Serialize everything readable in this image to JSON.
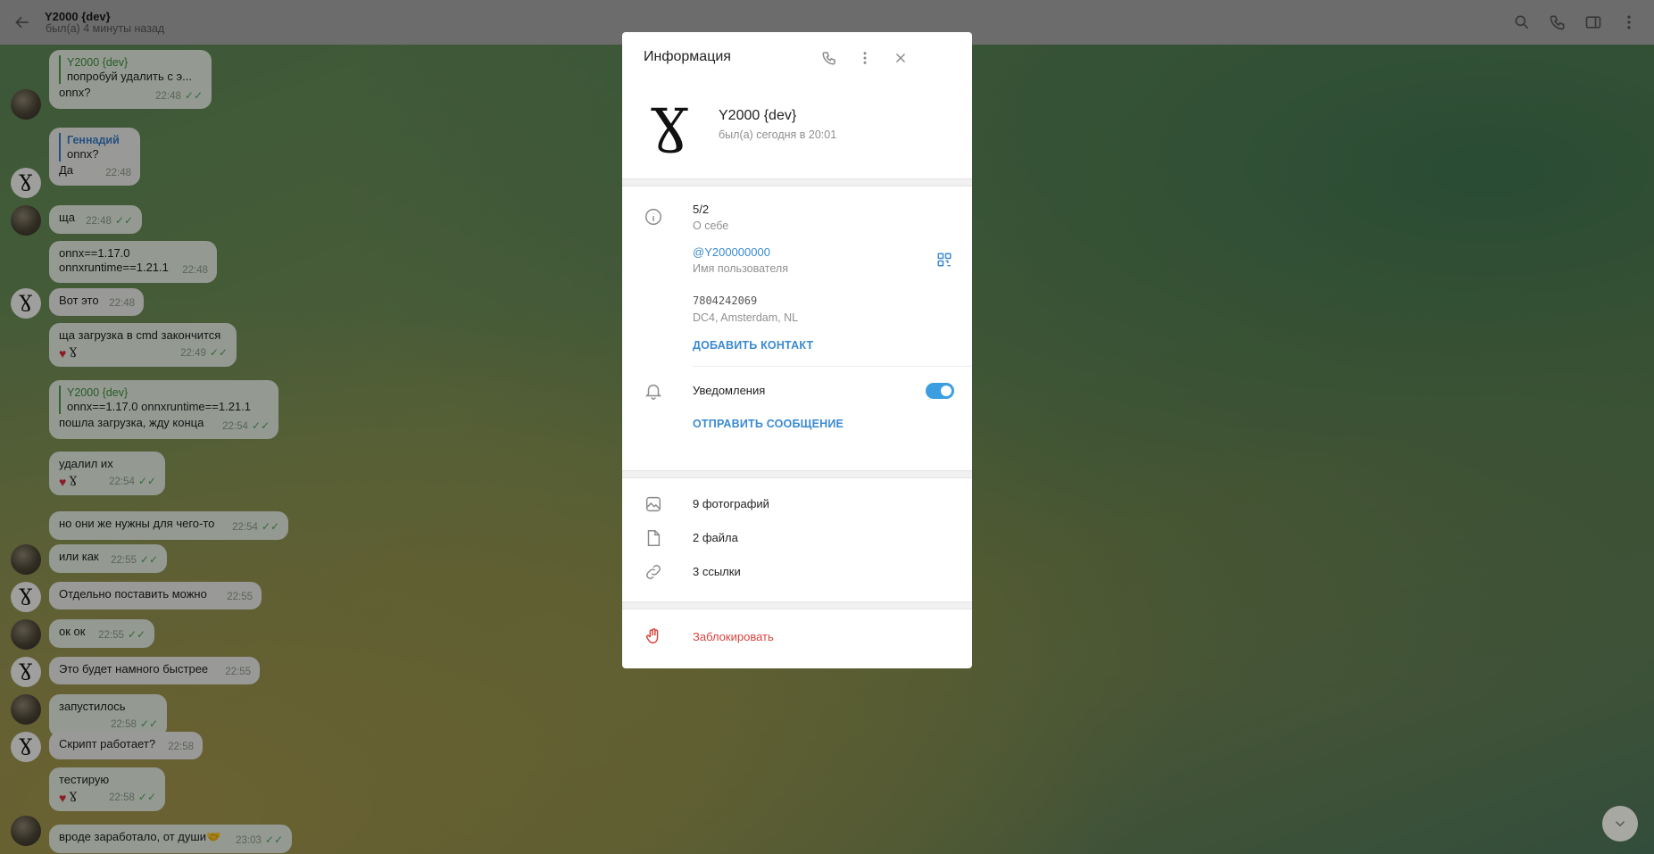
{
  "header": {
    "title": "Y2000 {dev}",
    "status": "был(а) 4 минуты назад"
  },
  "messages": [
    {
      "reply_name": "Y2000 {dev}",
      "reply_text": "попробуй удалить с э...",
      "text": "onnx?",
      "time": "22:48"
    },
    {
      "reply_name": "Геннадий",
      "reply_text": "onnx?",
      "text": "Да",
      "time": "22:48"
    },
    {
      "text": "ща",
      "time": "22:48"
    },
    {
      "text_line1": "onnx==1.17.0",
      "text_line2": "onnxruntime==1.21.1",
      "time": "22:48"
    },
    {
      "text": "Вот это",
      "time": "22:48"
    },
    {
      "text": "ща загрузка в cmd закончится",
      "time": "22:49"
    },
    {
      "reply_name": "Y2000 {dev}",
      "reply_text": "onnx==1.17.0 onnxruntime==1.21.1",
      "text": "пошла загрузка, жду конца",
      "time": "22:54"
    },
    {
      "text": "удалил их",
      "time": "22:54"
    },
    {
      "text": "но они же нужны для чего-то",
      "time": "22:54"
    },
    {
      "text": "или как",
      "time": "22:55"
    },
    {
      "text": "Отдельно поставить можно",
      "time": "22:55"
    },
    {
      "text": "ок ок",
      "time": "22:55"
    },
    {
      "text": "Это будет намного быстрее",
      "time": "22:55"
    },
    {
      "text": "запустилось",
      "time": "22:58"
    },
    {
      "text": "Скрипт работает?",
      "time": "22:58"
    },
    {
      "text": "тестирую",
      "time": "22:58"
    },
    {
      "text": "вроде заработало, от души🤝",
      "time": "23:03"
    }
  ],
  "modal": {
    "title": "Информация",
    "name": "Y2000 {dev}",
    "last_seen": "был(а) сегодня в 20:01",
    "bio": "5/2",
    "bio_label": "О себе",
    "username": "@Y200000000",
    "username_label": "Имя пользователя",
    "phone": "7804242069",
    "dc": "DC4, Amsterdam, NL",
    "add_contact": "ДОБАВИТЬ КОНТАКТ",
    "notifications": "Уведомления",
    "notifications_on": true,
    "send_message": "ОТПРАВИТЬ СООБЩЕНИЕ",
    "photos": "9 фотографий",
    "files": "2 файла",
    "links": "3 ссылки",
    "block": "Заблокировать"
  },
  "colors": {
    "accent": "#3a8ad1",
    "danger": "#d8433c",
    "toggle": "#3a9ee0"
  }
}
